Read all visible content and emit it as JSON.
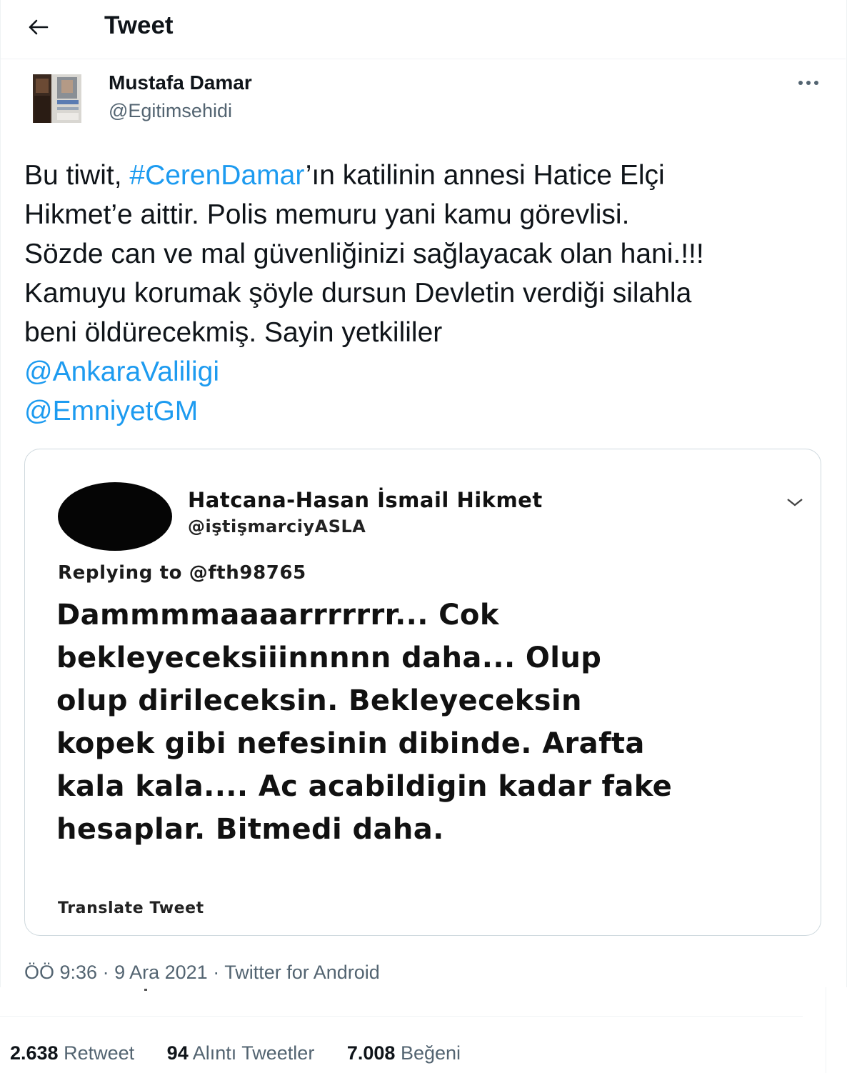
{
  "header": {
    "title": "Tweet"
  },
  "author": {
    "name": "Mustafa Damar",
    "handle": "@Egitimsehidi"
  },
  "tweet": {
    "lines": [
      {
        "pre": "Bu tiwit, ",
        "link": "#CerenDamar",
        "post": "’ın katilinin annesi Hatice Elçi"
      },
      {
        "text": "Hikmet’e aittir. Polis memuru yani kamu görevlisi."
      },
      {
        "text": "Sözde can ve mal güvenliğinizi sağlayacak olan hani.!!!"
      },
      {
        "text": "Kamuyu korumak şöyle dursun Devletin verdiği silahla"
      },
      {
        "text": "beni öldürecekmiş. Sayin yetkililer"
      }
    ],
    "mentions": [
      "@AnkaraValiligi",
      "@EmniyetGM"
    ]
  },
  "embedded": {
    "name": "Hatcana-Hasan İsmail Hikmet",
    "handle": "@iştişmarciyASLA",
    "replying": "Replying to @fth98765",
    "lines": [
      "Dammmmaaaarrrrrrr... Cok",
      "bekleyeceksiiinnnnn daha... Olup",
      "olup dirileceksin. Bekleyeceksin",
      "kopek gibi nefesinin dibinde. Arafta",
      "kala kala.... Ac acabildigin kadar fake",
      "hesaplar. Bitmedi daha."
    ],
    "translate": "Translate Tweet"
  },
  "meta": {
    "time": "ÖÖ 9:36",
    "date": "9 Ara 2021",
    "source": "Twitter for Android",
    "sep": " · "
  },
  "stats": [
    {
      "num": "2.638",
      "label": "Retweet"
    },
    {
      "num": "94",
      "label": "Alıntı Tweetler"
    },
    {
      "num": "7.008",
      "label": "Beğeni"
    }
  ],
  "colors": {
    "link": "#1d9bf0",
    "muted": "#536471",
    "text": "#0f1419",
    "border": "#cfd9de"
  },
  "icons": {
    "back": "arrow-left-icon",
    "more": "more-icon",
    "caret": "chevron-down-icon"
  }
}
